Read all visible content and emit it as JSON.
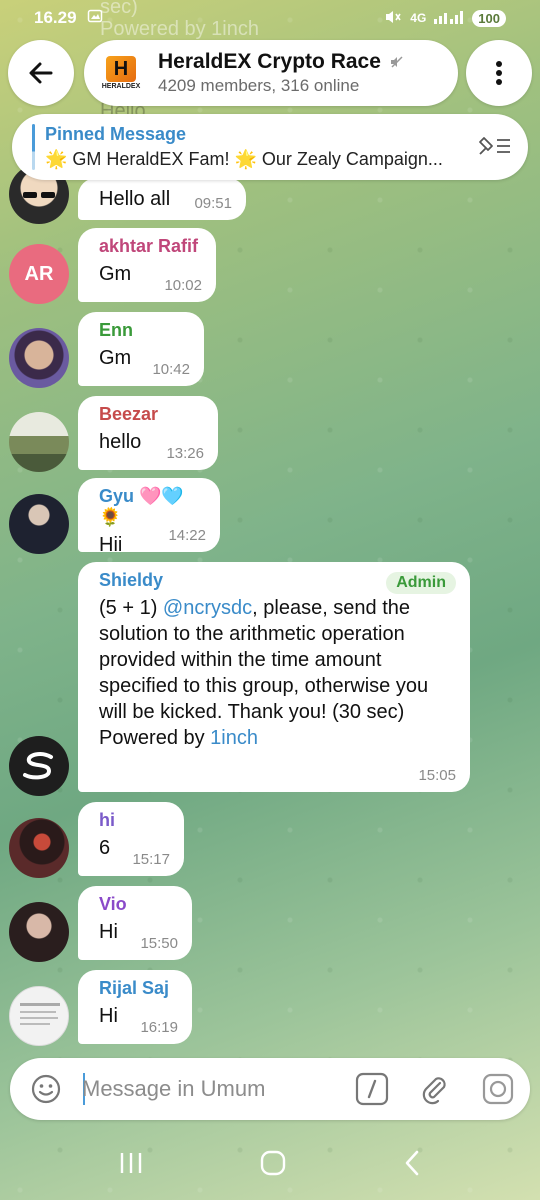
{
  "status_bar": {
    "time": "16.29",
    "network": "4G",
    "battery": "100"
  },
  "header": {
    "title": "HeraldEX Crypto Race",
    "subtitle": "4209 members, 316 online",
    "logo_text": "HERALDEX"
  },
  "pinned": {
    "title": "Pinned Message",
    "text": "🌟 GM HeraldEX Fam! 🌟  Our Zealy Campaign..."
  },
  "ghost": {
    "line1": "sec)",
    "line2": "Powered by 1inch",
    "line3": "Hello"
  },
  "messages": [
    {
      "sender": "",
      "text": "Hello all",
      "time": "09:51"
    },
    {
      "sender": "akhtar Rafif",
      "initials": "AR",
      "text": "Gm",
      "time": "10:02",
      "color": "#c0477a"
    },
    {
      "sender": "Enn",
      "text": "Gm",
      "time": "10:42",
      "color": "#3a9a3a"
    },
    {
      "sender": "Beezar",
      "text": "hello",
      "time": "13:26",
      "color": "#c64b4b"
    },
    {
      "sender": "Gyu 🩷🩵🌻",
      "text": "Hii",
      "time": "14:22",
      "color": "#3a8bc9"
    },
    {
      "sender": "Shieldy",
      "badge": "Admin",
      "text_pre": "(5 + 1) ",
      "mention": "@ncrysdc",
      "text_post": ", please, send the solution to the arithmetic operation provided within the time amount specified to this group, otherwise you will be kicked. Thank you! (30 sec)",
      "powered_pre": "Powered by ",
      "powered_link": "1inch",
      "time": "15:05",
      "color": "#3a8bc9"
    },
    {
      "sender": "hi",
      "text": "6",
      "time": "15:17",
      "color": "#7a5ac9"
    },
    {
      "sender": "Vio",
      "text": "Hi",
      "time": "15:50",
      "color": "#8a4ac9"
    },
    {
      "sender": "Rijal Saj",
      "text": "Hi",
      "time": "16:19",
      "color": "#3a8bc9"
    }
  ],
  "input": {
    "placeholder": "Message in Umum"
  },
  "colors": {
    "accent": "#3a8bc9",
    "bubble": "#ffffff",
    "admin_badge": "#3a9a3a"
  }
}
